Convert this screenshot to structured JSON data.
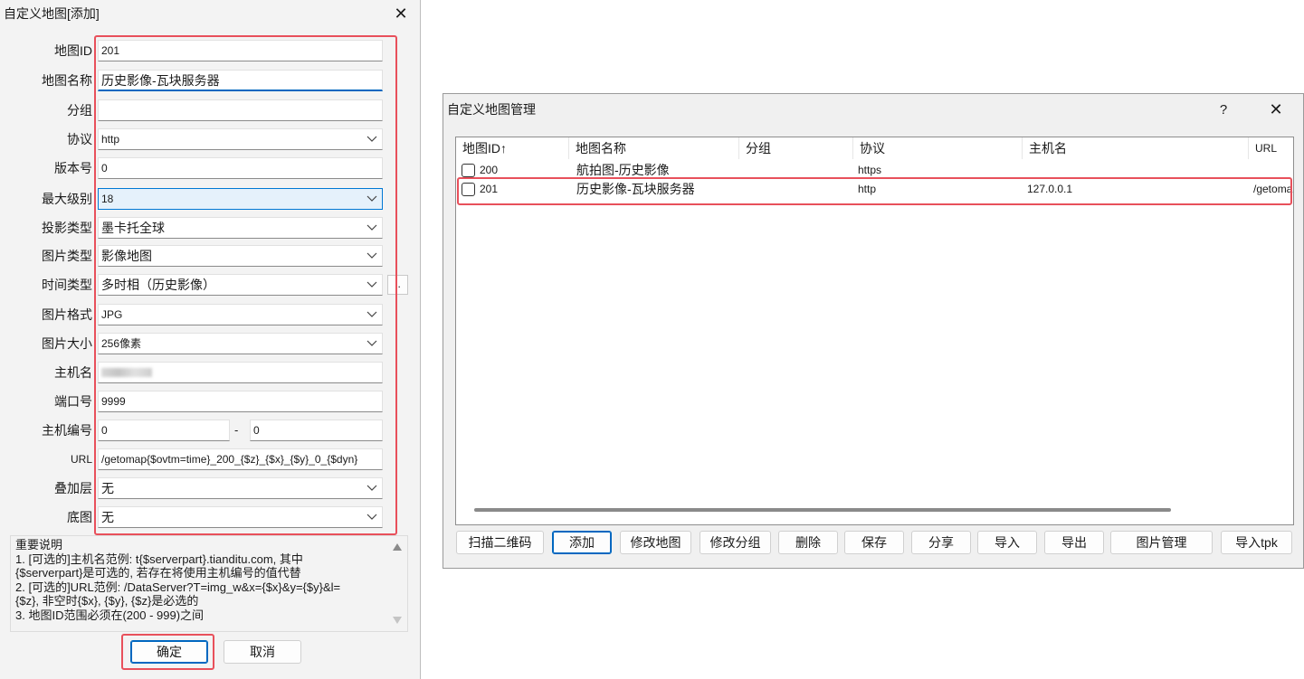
{
  "add_dialog": {
    "title": "自定义地图[添加]",
    "fields": {
      "map_id": {
        "label": "地图ID",
        "value": "201"
      },
      "map_name": {
        "label": "地图名称",
        "value": "历史影像-瓦块服务器"
      },
      "group": {
        "label": "分组",
        "value": ""
      },
      "protocol": {
        "label": "协议",
        "value": "http"
      },
      "version": {
        "label": "版本号",
        "value": "0"
      },
      "max_level": {
        "label": "最大级别",
        "value": "18"
      },
      "projection": {
        "label": "投影类型",
        "value": "墨卡托全球"
      },
      "image_type": {
        "label": "图片类型",
        "value": "影像地图"
      },
      "time_type": {
        "label": "时间类型",
        "value": "多时相（历史影像）",
        "more_label": ".."
      },
      "image_format": {
        "label": "图片格式",
        "value": "JPG"
      },
      "image_size": {
        "label": "图片大小",
        "value": "256像素"
      },
      "host": {
        "label": "主机名",
        "value": ""
      },
      "port": {
        "label": "端口号",
        "value": "9999"
      },
      "host_index": {
        "label": "主机编号",
        "from": "0",
        "separator": "-",
        "to": "0"
      },
      "url": {
        "label": "URL",
        "value": "/getomap{$ovtm=time}_200_{$z}_{$x}_{$y}_0_{$dyn}"
      },
      "overlay": {
        "label": "叠加层",
        "value": "无"
      },
      "base_map": {
        "label": "底图",
        "value": "无"
      }
    },
    "notes": {
      "title": "重要说明",
      "lines": [
        "1. [可选的]主机名范例: t{$serverpart}.tianditu.com, 其中",
        "{$serverpart}是可选的, 若存在将使用主机编号的值代替",
        "2. [可选的]URL范例: /DataServer?T=img_w&x={$x}&y={$y}&l=",
        "{$z}, 非空时{$x}, {$y}, {$z}是必选的",
        "3. 地图ID范围必须在(200 - 999)之间"
      ]
    },
    "buttons": {
      "ok": "确定",
      "cancel": "取消"
    }
  },
  "manage_dialog": {
    "title": "自定义地图管理",
    "help": "?",
    "columns": [
      "地图ID↑",
      "地图名称",
      "分组",
      "协议",
      "主机名",
      "URL"
    ],
    "rows": [
      {
        "id": "200",
        "name": "航拍图-历史影像",
        "group": "",
        "protocol": "https",
        "host": "",
        "url": ""
      },
      {
        "id": "201",
        "name": "历史影像-瓦块服务器",
        "group": "",
        "protocol": "http",
        "host": "127.0.0.1",
        "url": "/getoma"
      }
    ],
    "buttons": [
      "扫描二维码",
      "添加",
      "修改地图",
      "修改分组",
      "删除",
      "保存",
      "分享",
      "导入",
      "导出",
      "图片管理",
      "导入tpk"
    ]
  },
  "colors": {
    "highlight": "#e8505b",
    "focus": "#0067c0"
  }
}
